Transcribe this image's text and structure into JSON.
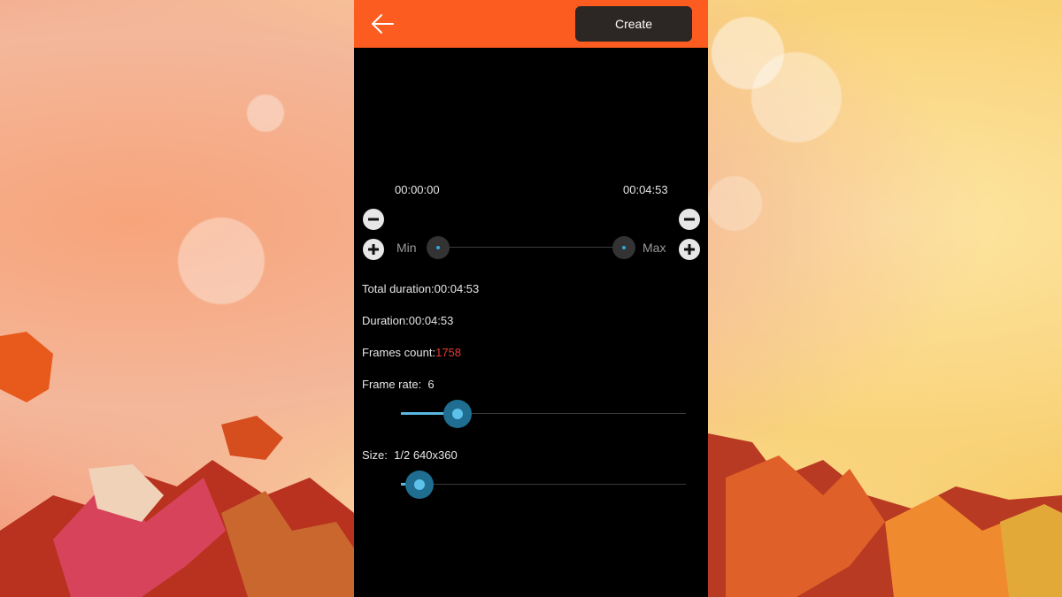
{
  "toolbar": {
    "back_icon": "arrow-left-icon",
    "create_label": "Create",
    "accent_color": "#fc5c20"
  },
  "trim": {
    "start_time": "00:00:00",
    "end_time": "00:04:53",
    "min_label": "Min",
    "max_label": "Max",
    "start_fraction": 0.0,
    "end_fraction": 1.0
  },
  "info": {
    "total_duration": "Total duration:00:04:53",
    "duration": "Duration:00:04:53",
    "frames_count_label": "Frames count:",
    "frames_count_value": "1758",
    "frame_rate_label": "Frame rate:",
    "frame_rate_value": "6",
    "frame_rate_fraction": 0.2,
    "size_label": "Size:",
    "size_value": "1/2 640x360",
    "size_fraction": 0.065
  }
}
